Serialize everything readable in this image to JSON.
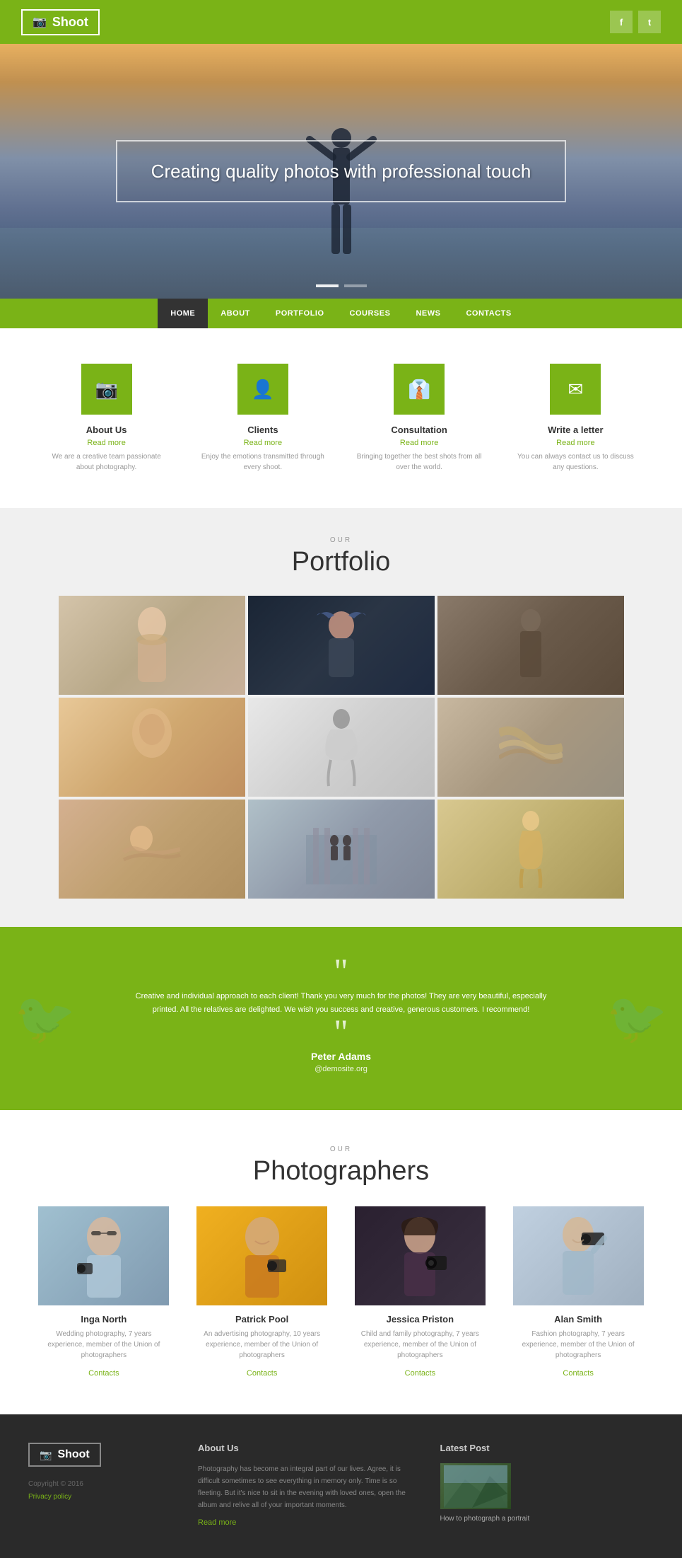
{
  "header": {
    "logo": "Shoot",
    "social": {
      "facebook": "f",
      "twitter": "t"
    }
  },
  "hero": {
    "title": "Creating quality photos with professional touch",
    "dots": [
      {
        "active": true
      },
      {
        "active": false
      }
    ]
  },
  "nav": {
    "items": [
      {
        "label": "HOME",
        "active": true
      },
      {
        "label": "ABOUT",
        "active": false
      },
      {
        "label": "PORTFOLIO",
        "active": false
      },
      {
        "label": "COURSES",
        "active": false
      },
      {
        "label": "NEWS",
        "active": false
      },
      {
        "label": "CONTACTS",
        "active": false
      }
    ]
  },
  "features": [
    {
      "icon": "📷",
      "title": "About Us",
      "link": "Read more",
      "desc": "We are a creative team passionate about photography."
    },
    {
      "icon": "👤",
      "title": "Clients",
      "link": "Read more",
      "desc": "Enjoy the emotions transmitted through every shoot."
    },
    {
      "icon": "👔",
      "title": "Consultation",
      "link": "Read more",
      "desc": "Bringing together the best shots from all over the world."
    },
    {
      "icon": "✉",
      "title": "Write a letter",
      "link": "Read more",
      "desc": "You can always contact us to discuss any questions."
    }
  ],
  "portfolio": {
    "label": "OUR",
    "title": "Portfolio",
    "images": [
      {
        "id": "p1",
        "alt": "Blonde portrait"
      },
      {
        "id": "p2",
        "alt": "Feather hat portrait"
      },
      {
        "id": "p3",
        "alt": "Urban man"
      },
      {
        "id": "p4",
        "alt": "Warm portrait"
      },
      {
        "id": "p5",
        "alt": "Dancing figure"
      },
      {
        "id": "p6",
        "alt": "Hair detail"
      },
      {
        "id": "p7",
        "alt": "Resting woman"
      },
      {
        "id": "p8",
        "alt": "City couple"
      },
      {
        "id": "p9",
        "alt": "Field woman"
      }
    ]
  },
  "testimonial": {
    "quote": "Creative and individual approach to each client! Thank you very much for the photos! They are very beautiful, especially printed. All the relatives are delighted. We wish you success and creative, generous customers. I recommend!",
    "author": "Peter Adams",
    "link": "@demosite.org"
  },
  "photographers": {
    "label": "OUR",
    "title": "Photographers",
    "items": [
      {
        "name": "Inga North",
        "desc": "Wedding photography, 7 years experience, member of the Union of photographers",
        "link": "Contacts"
      },
      {
        "name": "Patrick Pool",
        "desc": "An advertising photography, 10 years experience, member of the Union of photographers",
        "link": "Contacts"
      },
      {
        "name": "Jessica Priston",
        "desc": "Child and family photography, 7 years experience, member of the Union of photographers",
        "link": "Contacts"
      },
      {
        "name": "Alan Smith",
        "desc": "Fashion photography, 7 years experience, member of the Union of photographers",
        "link": "Contacts"
      }
    ]
  },
  "footer": {
    "logo": "Shoot",
    "copyright": "Copyright © 2016",
    "privacy": "Privacy policy",
    "about_title": "About Us",
    "about_text": "Photography has become an integral part of our lives. Agree, it is difficult sometimes to see everything in memory only. Time is so fleeting. But it's nice to sit in the evening with loved ones, open the album and relive all of your important moments.",
    "about_read_more": "Read more",
    "latest_title": "Latest Post",
    "latest_post": {
      "title": "How to photograph a portrait",
      "thumb_alt": "Mountain landscape"
    }
  }
}
